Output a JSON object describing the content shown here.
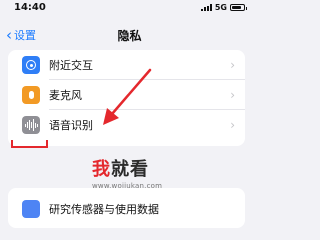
{
  "status": {
    "time": "14:40",
    "network": "5G"
  },
  "nav": {
    "back_label": "设置",
    "title": "隐私"
  },
  "rows": [
    {
      "label": "附近交互",
      "icon": "nearby-interaction-icon"
    },
    {
      "label": "麦克风",
      "icon": "microphone-icon"
    },
    {
      "label": "语音识别",
      "icon": "speech-recognition-icon"
    }
  ],
  "annotation": {
    "arrow_color": "#e4282d"
  },
  "watermark": {
    "text_first": "我",
    "text_rest": "就看",
    "url": "www.wojiukan.com"
  },
  "bottom_row": {
    "label": "研究传感器与使用数据"
  },
  "colors": {
    "accent": "#1a7bff",
    "mic": "#f29a25",
    "nearby": "#2f7ef6"
  }
}
